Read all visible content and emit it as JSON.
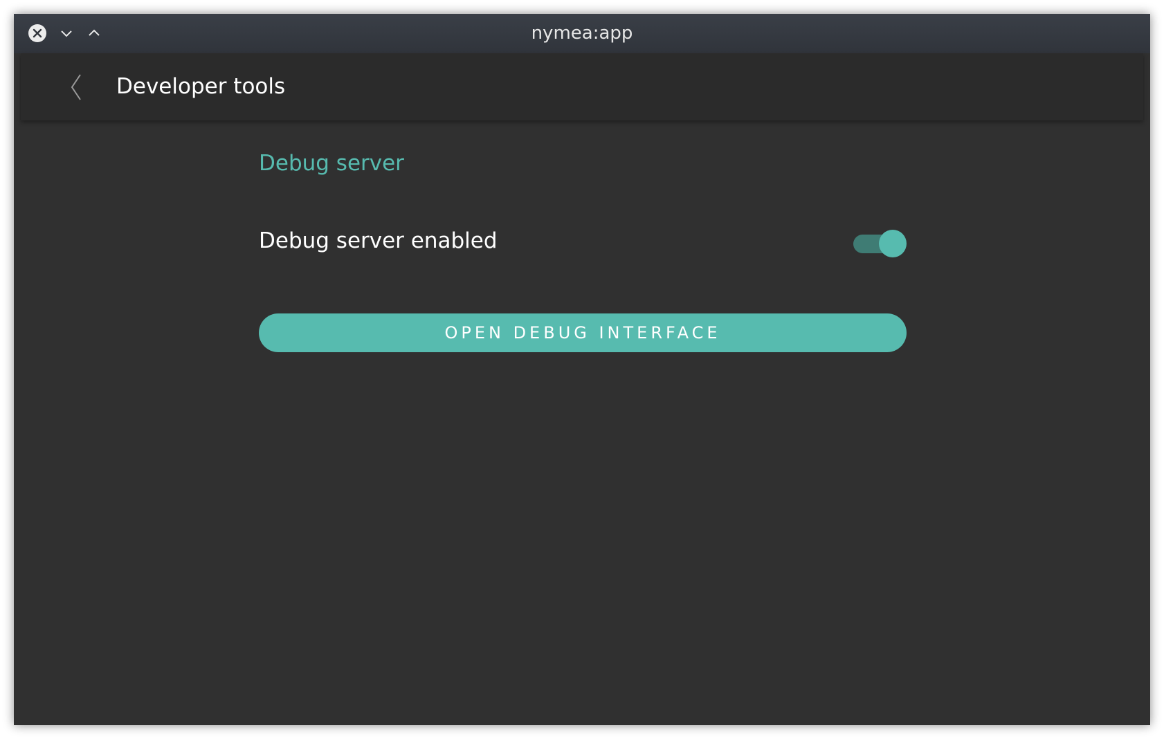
{
  "window": {
    "title": "nymea:app",
    "controls": {
      "close_icon": "close-icon",
      "minimize_icon": "chevron-down-icon",
      "maximize_icon": "chevron-up-icon"
    }
  },
  "header": {
    "back_icon": "chevron-left-icon",
    "title": "Developer tools"
  },
  "main": {
    "section_title": "Debug server",
    "debug_server_setting": {
      "label": "Debug server enabled",
      "enabled": true
    },
    "open_button_label": "OPEN DEBUG INTERFACE"
  },
  "colors": {
    "accent": "#57bbaf",
    "background": "#303030",
    "header": "#2b2b2b"
  }
}
